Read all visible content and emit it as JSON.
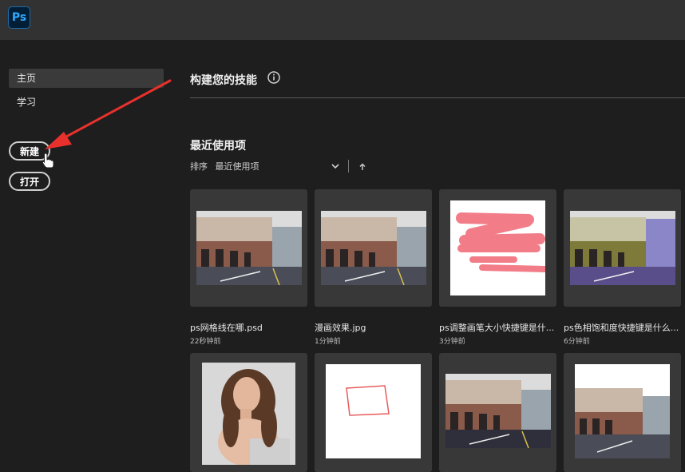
{
  "app": {
    "logo_text": "Ps"
  },
  "sidebar": {
    "nav": [
      {
        "label": "主页",
        "active": true
      },
      {
        "label": "学习",
        "active": false
      }
    ],
    "new_label": "新建",
    "open_label": "打开"
  },
  "main": {
    "skills_title": "构建您的技能",
    "recent_title": "最近使用项",
    "sort_label": "排序",
    "sort_value": "最近使用项",
    "files": [
      {
        "name": "ps网格线在哪.psd",
        "time": "22秒钟前",
        "thumb": "street"
      },
      {
        "name": "漫画效果.jpg",
        "time": "1分钟前",
        "thumb": "street"
      },
      {
        "name": "ps调整画笔大小快捷键是什...",
        "time": "3分钟前",
        "thumb": "pink-strokes"
      },
      {
        "name": "ps色相饱和度快捷键是什么...",
        "time": "6分钟前",
        "thumb": "street-purple"
      },
      {
        "name": "",
        "time": "",
        "thumb": "portrait"
      },
      {
        "name": "",
        "time": "",
        "thumb": "quad"
      },
      {
        "name": "",
        "time": "",
        "thumb": "street"
      },
      {
        "name": "",
        "time": "",
        "thumb": "street"
      }
    ]
  },
  "colors": {
    "accent": "#31a8ff",
    "annotation_arrow": "#e8312c",
    "stroke_pink": "#f27c87"
  },
  "icons": [
    "ps-logo-icon",
    "info-icon",
    "chevron-down-icon",
    "sort-arrow-up-icon",
    "annotation-arrow-icon",
    "hand-cursor-icon"
  ]
}
